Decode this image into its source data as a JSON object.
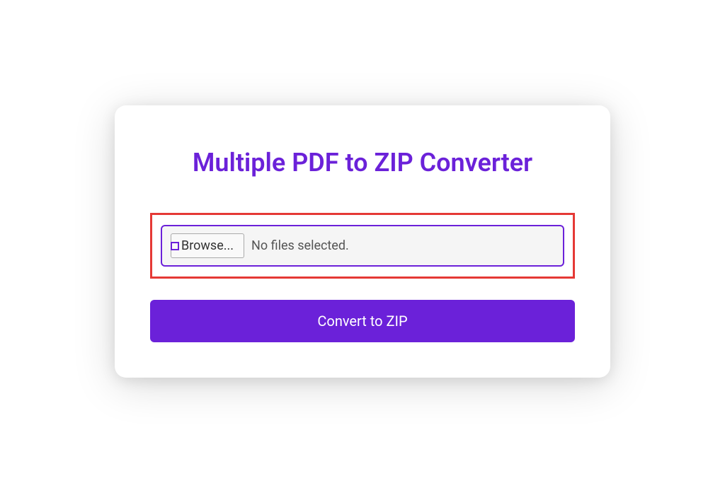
{
  "card": {
    "title": "Multiple PDF to ZIP Converter",
    "file_input": {
      "browse_label": "Browse...",
      "status_text": "No files selected."
    },
    "convert_button_label": "Convert to ZIP"
  },
  "colors": {
    "accent": "#6b21d9",
    "highlight": "#e53935"
  }
}
